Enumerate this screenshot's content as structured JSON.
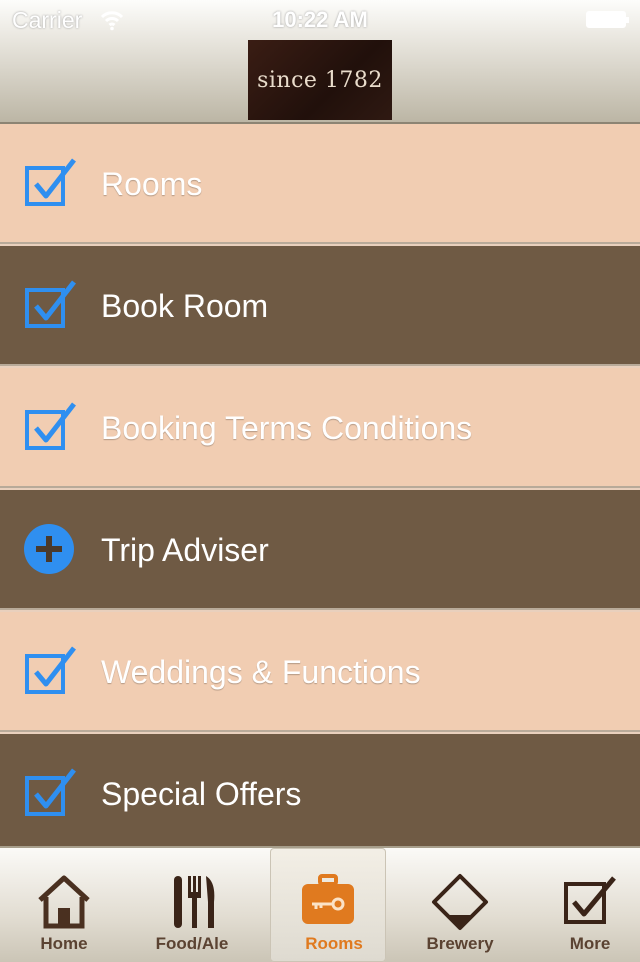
{
  "status_bar": {
    "carrier": "Carrier",
    "time": "10:22 AM"
  },
  "header": {
    "logo_text": "since 1782"
  },
  "menu": {
    "items": [
      {
        "label": "Rooms",
        "icon": "checkbox-icon"
      },
      {
        "label": "Book Room",
        "icon": "checkbox-icon"
      },
      {
        "label": "Booking Terms Conditions",
        "icon": "checkbox-icon"
      },
      {
        "label": "Trip Adviser",
        "icon": "plus-circle-icon"
      },
      {
        "label": "Weddings & Functions",
        "icon": "checkbox-icon"
      },
      {
        "label": "Special Offers",
        "icon": "checkbox-icon"
      }
    ]
  },
  "tabbar": {
    "tabs": [
      {
        "label": "Home",
        "icon": "house-icon"
      },
      {
        "label": "Food/Ale",
        "icon": "cutlery-icon"
      },
      {
        "label": "Rooms",
        "icon": "briefcase-key-icon",
        "active": true
      },
      {
        "label": "Brewery",
        "icon": "brewery-icon"
      },
      {
        "label": "More",
        "icon": "checkbox-icon"
      }
    ]
  },
  "colors": {
    "accent_blue": "#2f8ff0",
    "active_tab": "#e07a1f",
    "tab_text": "#5b4332"
  }
}
